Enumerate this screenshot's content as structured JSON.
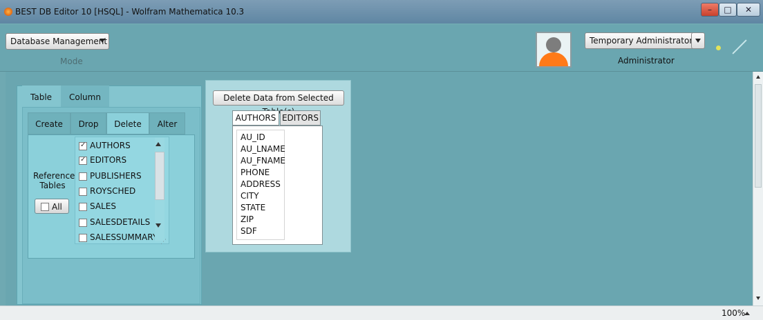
{
  "window": {
    "title": "BEST DB Editor 10 [HSQL] - Wolfram Mathematica 10.3"
  },
  "header": {
    "mode_select_label": "Database Management",
    "mode_caption": "Mode",
    "user_select_label": "Temporary Administrator",
    "role_caption": "Administrator"
  },
  "left_panel": {
    "tabs": [
      "Table",
      "Column"
    ],
    "sub_tabs": [
      "Create",
      "Drop",
      "Delete",
      "Alter"
    ],
    "reference_tables_label": "Reference\nTables",
    "all_button_label": "All",
    "tables": [
      {
        "label": "AUTHORS",
        "checked": true
      },
      {
        "label": "EDITORS",
        "checked": true
      },
      {
        "label": "PUBLISHERS",
        "checked": false
      },
      {
        "label": "ROYSCHED",
        "checked": false
      },
      {
        "label": "SALES",
        "checked": false
      },
      {
        "label": "SALESDETAILS",
        "checked": false
      },
      {
        "label": "SALESSUMMARY",
        "checked": false
      }
    ]
  },
  "center_panel": {
    "delete_button_label": "Delete Data from Selected Table(s)",
    "table_tabs": [
      "AUTHORS",
      "EDITORS"
    ],
    "columns": [
      "AU_ID",
      "AU_LNAME",
      "AU_FNAME",
      "PHONE",
      "ADDRESS",
      "CITY",
      "STATE",
      "ZIP",
      "SDF"
    ]
  },
  "statusbar": {
    "zoom": "100%"
  }
}
